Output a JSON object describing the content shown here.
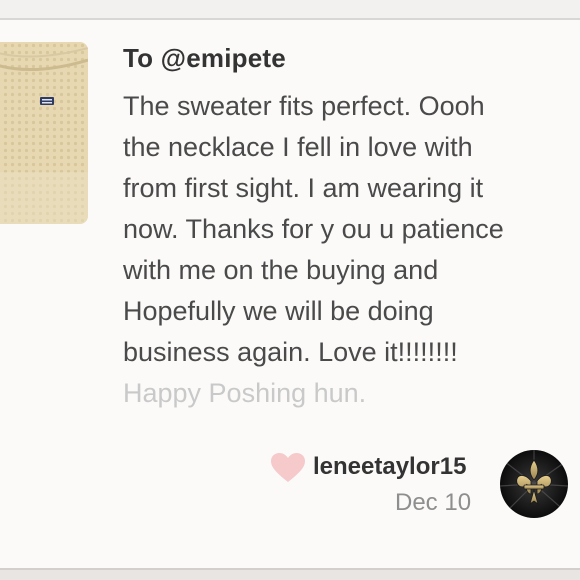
{
  "review": {
    "recipient": "To @emipete",
    "message_lines": [
      "The sweater fits perfect. Oooh",
      "the necklace I fell in love with",
      "from first sight. I am wearing it",
      "now. Thanks for y ou u patience",
      "with me on the buying and",
      "Hopefully we will be doing",
      "business again. Love it!!!!!!!!",
      "Happy Poshing hun."
    ],
    "author": "leneetaylor15",
    "date": "Dec 10"
  },
  "icons": {
    "like": "heart-icon",
    "avatar": "fleur-de-lis-avatar"
  },
  "colors": {
    "heart": "#f6c9cb",
    "text": "#4a4a4a",
    "muted": "#8e8e8e",
    "faded": "#c9c9c9",
    "sweater": "#e6d6ae"
  }
}
